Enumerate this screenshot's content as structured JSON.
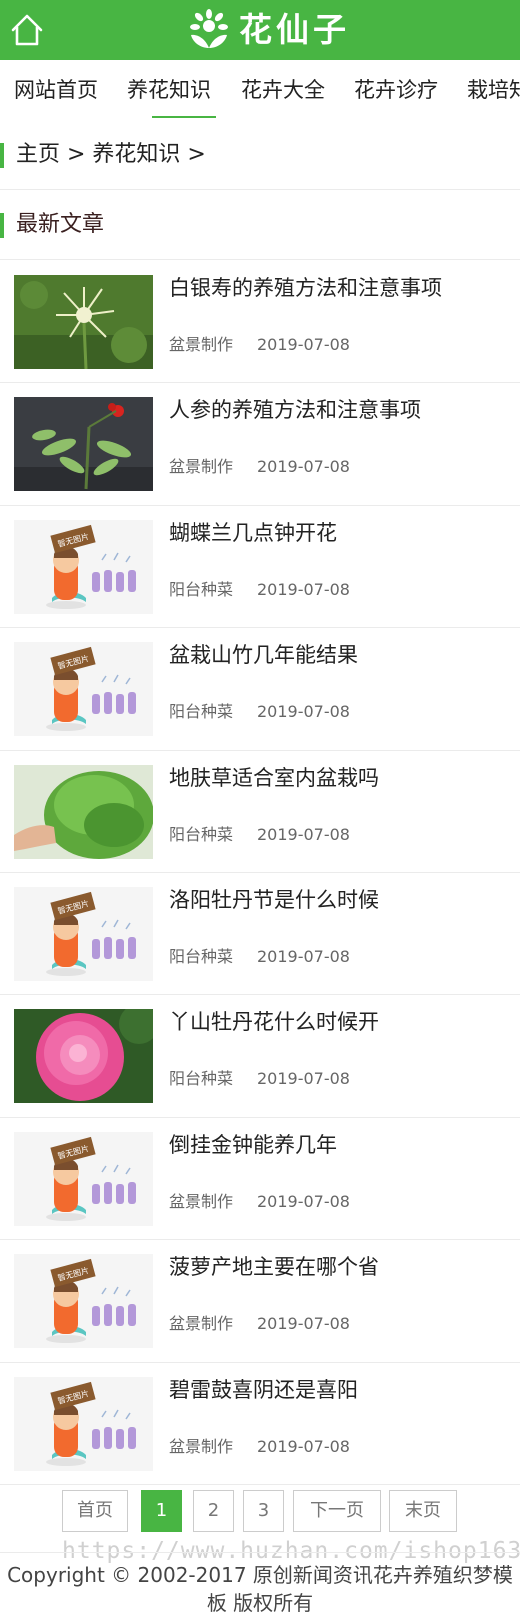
{
  "header": {
    "home_icon": "home-icon",
    "logo_icon": "lotus-logo-icon",
    "logo_text": "花仙子",
    "color": "#48b543"
  },
  "nav": {
    "items": [
      "网站首页",
      "养花知识",
      "花卉大全",
      "花卉诊疗",
      "栽培知"
    ],
    "active_index": 1
  },
  "breadcrumb": {
    "text": "主页 > 养花知识 >"
  },
  "section": {
    "title": "最新文章"
  },
  "articles": [
    {
      "title": "白银寿的养殖方法和注意事项",
      "category": "盆景制作",
      "date": "2019-07-08",
      "thumb": "white-flower"
    },
    {
      "title": "人参的养殖方法和注意事项",
      "category": "盆景制作",
      "date": "2019-07-08",
      "thumb": "ginseng"
    },
    {
      "title": "蝴蝶兰几点钟开花",
      "category": "阳台种菜",
      "date": "2019-07-08",
      "thumb": "no-image"
    },
    {
      "title": "盆栽山竹几年能结果",
      "category": "阳台种菜",
      "date": "2019-07-08",
      "thumb": "no-image"
    },
    {
      "title": "地肤草适合室内盆栽吗",
      "category": "阳台种菜",
      "date": "2019-07-08",
      "thumb": "green-bush"
    },
    {
      "title": "洛阳牡丹节是什么时候",
      "category": "阳台种菜",
      "date": "2019-07-08",
      "thumb": "no-image"
    },
    {
      "title": "丫山牡丹花什么时候开",
      "category": "阳台种菜",
      "date": "2019-07-08",
      "thumb": "pink-peony"
    },
    {
      "title": "倒挂金钟能养几年",
      "category": "盆景制作",
      "date": "2019-07-08",
      "thumb": "no-image"
    },
    {
      "title": "菠萝产地主要在哪个省",
      "category": "盆景制作",
      "date": "2019-07-08",
      "thumb": "no-image"
    },
    {
      "title": "碧雷鼓喜阴还是喜阳",
      "category": "盆景制作",
      "date": "2019-07-08",
      "thumb": "no-image"
    }
  ],
  "no_image_label": "暂无图片",
  "pagination": {
    "first": "首页",
    "pages": [
      "1",
      "2",
      "3"
    ],
    "current": "1",
    "next": "下一页",
    "last": "末页"
  },
  "watermark": "https://www.huzhan.com/ishop163",
  "footer": {
    "copyright": "Copyright © 2002-2017 原创新闻资讯花卉养殖织梦模板 版权所有"
  }
}
